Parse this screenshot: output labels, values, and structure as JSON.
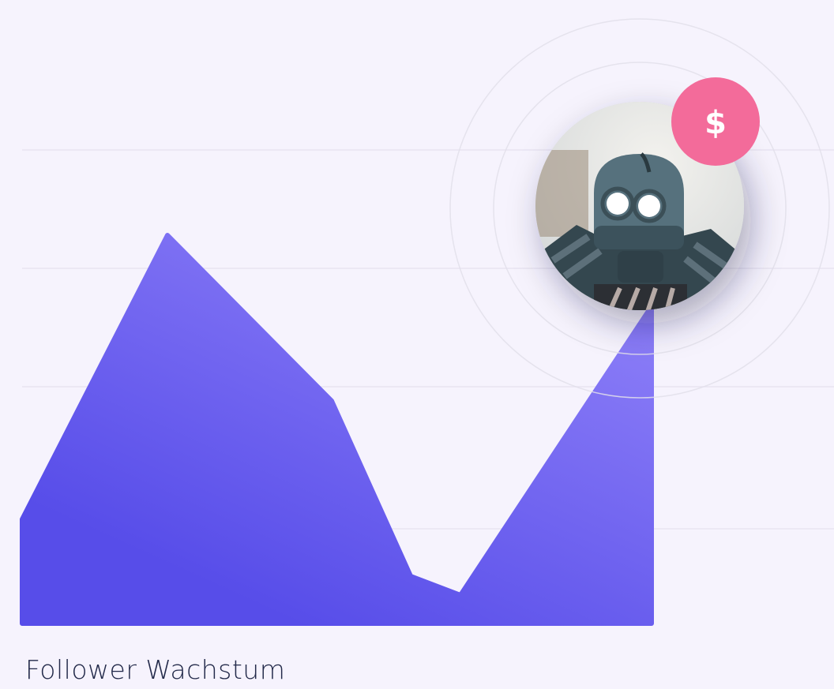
{
  "caption": "Follower Wachstum",
  "badge": {
    "symbol": "$",
    "color": "#f36b9a"
  },
  "avatar": {
    "subject": "robot-avatar"
  },
  "colors": {
    "area_start": "#574de9",
    "area_end": "#8a7cf7",
    "grid": "#e8e4f2",
    "ring": "#e2dfea",
    "background": "#f6f3fd"
  },
  "chart_data": {
    "type": "area",
    "x": [
      0,
      1,
      2,
      3,
      4,
      5
    ],
    "series": [
      {
        "values": [
          22,
          82,
          47,
          10,
          6,
          67
        ]
      }
    ],
    "ylim": [
      0,
      100
    ],
    "grid": true,
    "gridlines": [
      20,
      50,
      75,
      100
    ],
    "highlight_point": {
      "index": 5,
      "marker": "avatar-with-badge"
    }
  }
}
